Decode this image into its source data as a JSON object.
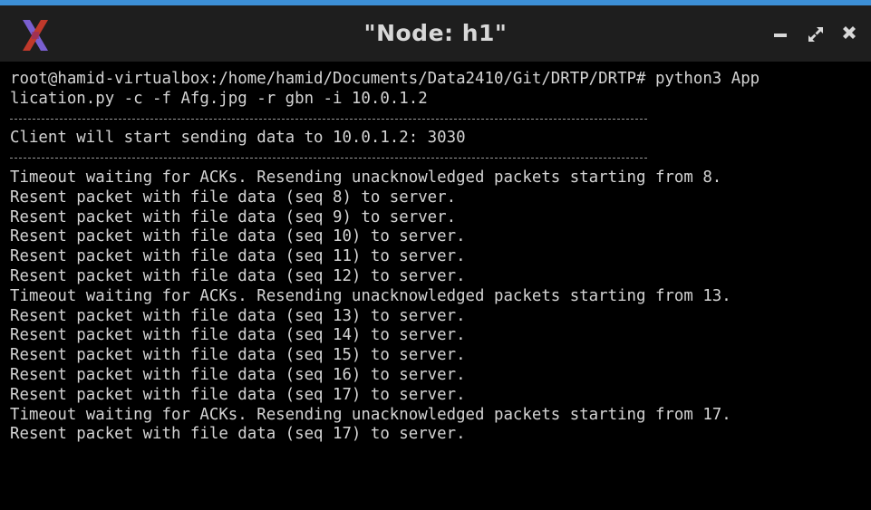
{
  "window": {
    "title": "\"Node: h1\"",
    "app_icon": "x-logo-icon",
    "controls": {
      "minimize": "minimize-icon",
      "maximize": "maximize-icon",
      "close": "close-icon"
    },
    "accent_color": "#3c8fd6"
  },
  "terminal": {
    "command_line_1": "root@hamid-virtualbox:/home/hamid/Documents/Data2410/Git/DRTP/DRTP# python3 App",
    "command_line_2": "lication.py -c -f Afg.jpg -r gbn -i 10.0.1.2",
    "client_start": "Client will start sending data to 10.0.1.2: 3030",
    "output_lines": [
      "Timeout waiting for ACKs. Resending unacknowledged packets starting from 8.",
      "Resent packet with file data (seq 8) to server.",
      "Resent packet with file data (seq 9) to server.",
      "Resent packet with file data (seq 10) to server.",
      "Resent packet with file data (seq 11) to server.",
      "Resent packet with file data (seq 12) to server.",
      "Timeout waiting for ACKs. Resending unacknowledged packets starting from 13.",
      "Resent packet with file data (seq 13) to server.",
      "Resent packet with file data (seq 14) to server.",
      "Resent packet with file data (seq 15) to server.",
      "Resent packet with file data (seq 16) to server.",
      "Resent packet with file data (seq 17) to server.",
      "Timeout waiting for ACKs. Resending unacknowledged packets starting from 17.",
      "Resent packet with file data (seq 17) to server."
    ]
  }
}
